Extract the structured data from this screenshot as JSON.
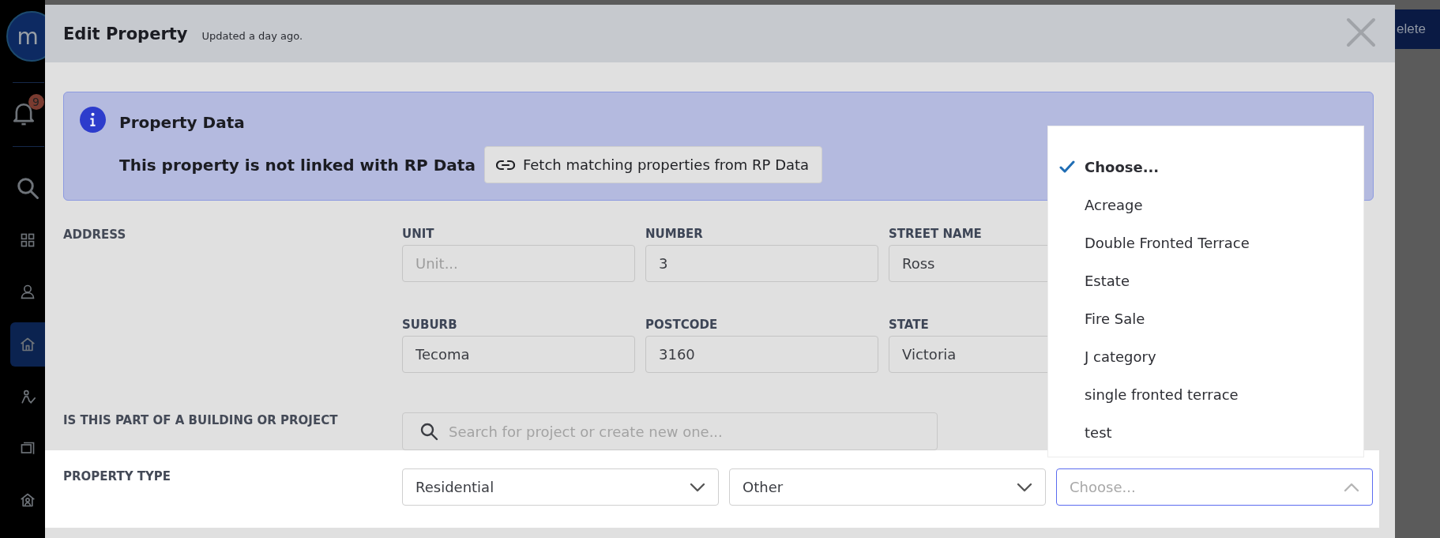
{
  "sidebar": {
    "logo": "m",
    "notification_badge": "9",
    "items": [
      {
        "kind": "search",
        "selected": false
      },
      {
        "kind": "grid",
        "selected": false
      },
      {
        "kind": "user",
        "selected": false
      },
      {
        "kind": "home",
        "selected": true
      },
      {
        "kind": "person-check",
        "selected": false
      },
      {
        "kind": "window",
        "selected": false
      },
      {
        "kind": "house-person",
        "selected": false
      }
    ]
  },
  "background_button": "elete",
  "modal": {
    "title": "Edit Property",
    "subtitle": "Updated a day ago."
  },
  "info": {
    "title": "Property Data",
    "message": "This property is not linked with RP Data",
    "button": "Fetch matching properties from RP Data"
  },
  "address": {
    "label": "ADDRESS",
    "fields": [
      {
        "label": "UNIT",
        "placeholder": "Unit..."
      },
      {
        "label": "NUMBER",
        "value": "3"
      },
      {
        "label": "STREET NAME",
        "value": "Ross"
      },
      {
        "label": "SUBURB",
        "value": "Tecoma"
      },
      {
        "label": "POSTCODE",
        "value": "3160"
      },
      {
        "label": "STATE",
        "value": "Victoria"
      }
    ]
  },
  "project": {
    "label": "IS THIS PART OF A BUILDING OR PROJECT",
    "placeholder": "Search for project or create new one..."
  },
  "property_type": {
    "label": "PROPERTY TYPE",
    "selects": [
      {
        "value": "Residential",
        "expanded": false
      },
      {
        "value": "Other",
        "expanded": false
      },
      {
        "placeholder": "Choose...",
        "expanded": true,
        "options": [
          {
            "label": "Choose...",
            "selected": true
          },
          {
            "label": "Acreage",
            "selected": false
          },
          {
            "label": "Double Fronted Terrace",
            "selected": false
          },
          {
            "label": "Estate",
            "selected": false
          },
          {
            "label": "Fire Sale",
            "selected": false
          },
          {
            "label": "J category",
            "selected": false
          },
          {
            "label": "single fronted terrace",
            "selected": false
          },
          {
            "label": "test",
            "selected": false
          }
        ]
      }
    ]
  }
}
